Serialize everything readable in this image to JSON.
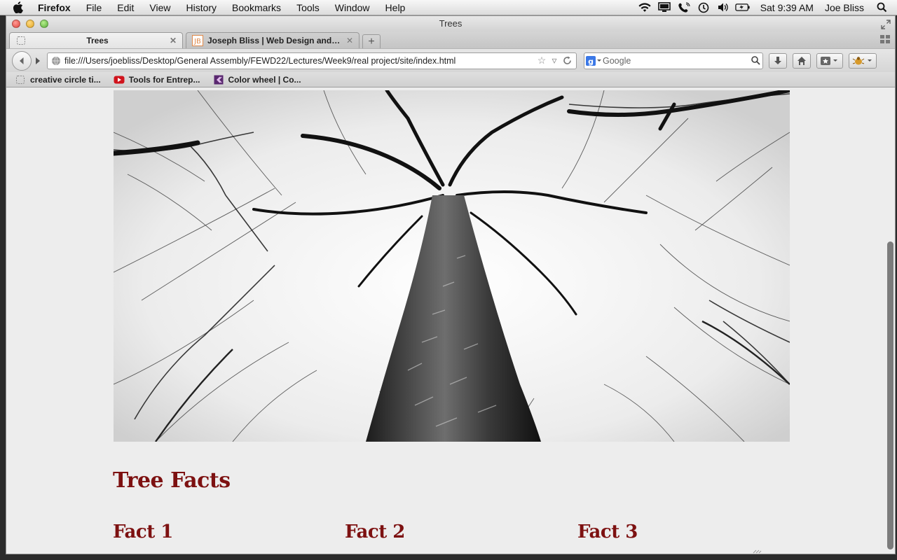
{
  "menubar": {
    "app_name": "Firefox",
    "items": [
      "File",
      "Edit",
      "View",
      "History",
      "Bookmarks",
      "Tools",
      "Window",
      "Help"
    ],
    "clock": "Sat 9:39 AM",
    "user": "Joe Bliss",
    "status_icons": [
      "wifi-icon",
      "display-icon",
      "phone-icon",
      "time-machine-icon",
      "volume-icon",
      "battery-icon"
    ]
  },
  "window": {
    "title": "Trees"
  },
  "tabs": [
    {
      "title": "Trees",
      "active": true,
      "favicon": "blank-page-icon"
    },
    {
      "title": "Joseph Bliss | Web Design and ...",
      "active": false,
      "favicon": "JB"
    }
  ],
  "navbar": {
    "url": "file:///Users/joebliss/Desktop/General Assembly/FEWD22/Lectures/Week9/real project/site/index.html",
    "search_placeholder": "Google",
    "search_engine": "google-icon"
  },
  "bookmarks": [
    {
      "label": "creative circle ti...",
      "icon": "blank-page-icon"
    },
    {
      "label": "Tools for Entrep...",
      "icon": "youtube-icon"
    },
    {
      "label": "Color wheel | Co...",
      "icon": "adobe-kuler-icon"
    }
  ],
  "page": {
    "heading": "Tree Facts",
    "facts": [
      "Fact 1",
      "Fact 2",
      "Fact 3"
    ],
    "accent_color": "#7d1111"
  }
}
